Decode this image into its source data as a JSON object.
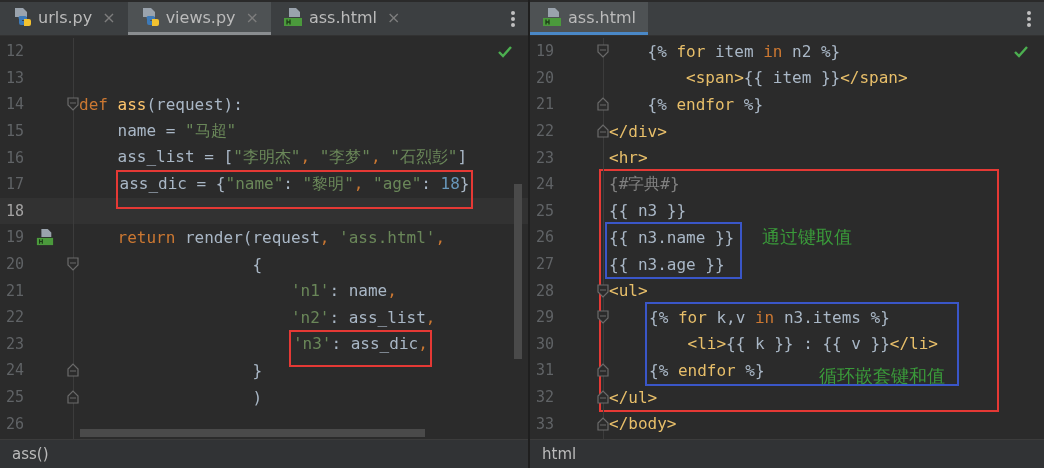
{
  "panes": [
    {
      "focused": false,
      "tabs": [
        {
          "label": "urls.py",
          "kind": "python",
          "selected": false,
          "close": "×"
        },
        {
          "label": "views.py",
          "kind": "python",
          "selected": true,
          "close": "×"
        },
        {
          "label": "ass.html",
          "kind": "html",
          "selected": false,
          "close": "×"
        }
      ],
      "code": [
        {
          "kind": "line",
          "number": "12"
        },
        {
          "kind": "line",
          "number": "13"
        },
        {
          "kind": "line",
          "number": "14",
          "gutter": {
            "kind": "fold-start"
          },
          "tokens": [
            {
              "kind": "keyword",
              "text": "def "
            },
            {
              "kind": "function",
              "text": "ass"
            },
            {
              "kind": "plain",
              "text": "(request):"
            }
          ]
        },
        {
          "kind": "line",
          "number": "15",
          "tokens": [
            {
              "kind": "plain",
              "text": "    name = "
            },
            {
              "kind": "string",
              "text": "\"马超\""
            }
          ]
        },
        {
          "kind": "line",
          "number": "16",
          "tokens": [
            {
              "kind": "plain",
              "text": "    ass_list = ["
            },
            {
              "kind": "string",
              "text": "\"李明杰\""
            },
            {
              "kind": "keyword",
              "text": ", "
            },
            {
              "kind": "string",
              "text": "\"李梦\""
            },
            {
              "kind": "keyword",
              "text": ", "
            },
            {
              "kind": "string",
              "text": "\"石烈彭\""
            },
            {
              "kind": "plain",
              "text": "]"
            }
          ]
        },
        {
          "kind": "line",
          "number": "17",
          "box": {
            "color": "#e53935",
            "tokens": [
              {
                "kind": "plain",
                "text": "ass_dic = {"
              },
              {
                "kind": "string",
                "text": "\"name\""
              },
              {
                "kind": "plain",
                "text": ": "
              },
              {
                "kind": "string",
                "text": "\"黎明\""
              },
              {
                "kind": "keyword",
                "text": ", "
              },
              {
                "kind": "string",
                "text": "\"age\""
              },
              {
                "kind": "plain",
                "text": ": "
              },
              {
                "kind": "number",
                "text": "18"
              },
              {
                "kind": "plain",
                "text": "}"
              }
            ]
          }
        },
        {
          "kind": "line",
          "number": "18",
          "current": true
        },
        {
          "kind": "line",
          "number": "19",
          "gutter": {
            "kind": "html-file"
          },
          "tokens": [
            {
              "kind": "keyword",
              "text": "    return"
            },
            {
              "kind": "plain",
              "text": " render(request"
            },
            {
              "kind": "keyword",
              "text": ", "
            },
            {
              "kind": "string",
              "text": "'ass.html'"
            },
            {
              "kind": "keyword",
              "text": ","
            }
          ]
        },
        {
          "kind": "line",
          "number": "20",
          "gutter": {
            "kind": "fold-start"
          },
          "tokens": [
            {
              "kind": "plain",
              "text": "                  {"
            }
          ]
        },
        {
          "kind": "line",
          "number": "21",
          "tokens": [
            {
              "kind": "string",
              "text": "                      'n1'"
            },
            {
              "kind": "plain",
              "text": ": name"
            },
            {
              "kind": "keyword",
              "text": ","
            }
          ]
        },
        {
          "kind": "line",
          "number": "22",
          "tokens": [
            {
              "kind": "string",
              "text": "                      'n2'"
            },
            {
              "kind": "plain",
              "text": ": ass_list"
            },
            {
              "kind": "keyword",
              "text": ","
            }
          ]
        },
        {
          "kind": "line",
          "number": "23",
          "box": {
            "color": "#e53935",
            "tokens": [
              {
                "kind": "string",
                "text": "'n3'"
              },
              {
                "kind": "plain",
                "text": ": ass_dic"
              },
              {
                "kind": "keyword",
                "text": ","
              }
            ]
          }
        },
        {
          "kind": "line",
          "number": "24",
          "gutter": {
            "kind": "fold-end"
          },
          "tokens": [
            {
              "kind": "plain",
              "text": "                  }"
            }
          ]
        },
        {
          "kind": "line",
          "number": "25",
          "gutter": {
            "kind": "fold-end"
          },
          "tokens": [
            {
              "kind": "plain",
              "text": "                  )"
            }
          ]
        },
        {
          "kind": "line",
          "number": "26"
        }
      ],
      "status": "ass()"
    },
    {
      "focused": true,
      "tabs": [
        {
          "label": "ass.html",
          "kind": "html",
          "selected": true
        }
      ],
      "code": [
        {
          "kind": "line",
          "number": "19",
          "gutter": {
            "kind": "fold-start"
          },
          "tokens": [
            {
              "kind": "plain",
              "text": "    {% "
            },
            {
              "kind": "tag",
              "text": "for"
            },
            {
              "kind": "plain",
              "text": " item "
            },
            {
              "kind": "keyword",
              "text": "in"
            },
            {
              "kind": "plain",
              "text": " n2 %}"
            }
          ]
        },
        {
          "kind": "line",
          "number": "20",
          "tokens": [
            {
              "kind": "tag",
              "text": "        <span>"
            },
            {
              "kind": "plain",
              "text": "{{ item }}"
            },
            {
              "kind": "tag",
              "text": "</span>"
            }
          ]
        },
        {
          "kind": "line",
          "number": "21",
          "gutter": {
            "kind": "fold-end"
          },
          "tokens": [
            {
              "kind": "plain",
              "text": "    {% "
            },
            {
              "kind": "tag",
              "text": "endfor"
            },
            {
              "kind": "plain",
              "text": " %}"
            }
          ]
        },
        {
          "kind": "line",
          "number": "22",
          "gutter": {
            "kind": "fold-end"
          },
          "tokens": [
            {
              "kind": "tag",
              "text": "</div>"
            }
          ]
        },
        {
          "kind": "line",
          "number": "23",
          "tokens": [
            {
              "kind": "tag",
              "text": "<hr>"
            }
          ]
        },
        {
          "kind": "group",
          "color": "#e53935",
          "children": [
            {
              "kind": "line",
              "number": "24",
              "tokens": [
                {
                  "kind": "comment",
                  "text": "{#字典#}"
                }
              ]
            },
            {
              "kind": "line",
              "number": "25",
              "tokens": [
                {
                  "kind": "plain",
                  "text": "{{ n3 }}"
                }
              ]
            },
            {
              "kind": "sidenote",
              "color": "#3a56c8",
              "note": "通过键取值",
              "children": [
                {
                  "kind": "line",
                  "number": "26",
                  "tokens": [
                    {
                      "kind": "plain",
                      "text": "{{ n3.name }}"
                    }
                  ]
                },
                {
                  "kind": "line",
                  "number": "27",
                  "tokens": [
                    {
                      "kind": "plain",
                      "text": "{{ n3.age }}"
                    }
                  ]
                }
              ]
            },
            {
              "kind": "line",
              "number": "28",
              "gutter": {
                "kind": "fold-start"
              },
              "tokens": [
                {
                  "kind": "tag",
                  "text": "<ul>"
                }
              ]
            },
            {
              "kind": "innernote",
              "color": "#3a56c8",
              "note": "循环嵌套键和值",
              "children": [
                {
                  "kind": "line",
                  "number": "29",
                  "gutter": {
                    "kind": "fold-start"
                  },
                  "tokens": [
                    {
                      "kind": "plain",
                      "text": "{% "
                    },
                    {
                      "kind": "tag",
                      "text": "for"
                    },
                    {
                      "kind": "plain",
                      "text": " k,v "
                    },
                    {
                      "kind": "keyword",
                      "text": "in"
                    },
                    {
                      "kind": "plain",
                      "text": " n3.items %}"
                    }
                  ]
                },
                {
                  "kind": "line",
                  "number": "30",
                  "tokens": [
                    {
                      "kind": "tag",
                      "text": "    <li>"
                    },
                    {
                      "kind": "plain",
                      "text": "{{ k }} : {{ v }}"
                    },
                    {
                      "kind": "tag",
                      "text": "</li>"
                    }
                  ]
                },
                {
                  "kind": "line",
                  "number": "31",
                  "gutter": {
                    "kind": "fold-end"
                  },
                  "tokens": [
                    {
                      "kind": "plain",
                      "text": "{% "
                    },
                    {
                      "kind": "tag",
                      "text": "endfor"
                    },
                    {
                      "kind": "plain",
                      "text": " %}"
                    }
                  ]
                }
              ]
            },
            {
              "kind": "line",
              "number": "32",
              "gutter": {
                "kind": "fold-end"
              },
              "tokens": [
                {
                  "kind": "tag",
                  "text": "</ul>"
                }
              ]
            }
          ]
        },
        {
          "kind": "line",
          "number": "33",
          "gutter": {
            "kind": "fold-end"
          },
          "tokens": [
            {
              "kind": "tag",
              "text": "</body>"
            }
          ]
        }
      ],
      "status": "html"
    }
  ]
}
